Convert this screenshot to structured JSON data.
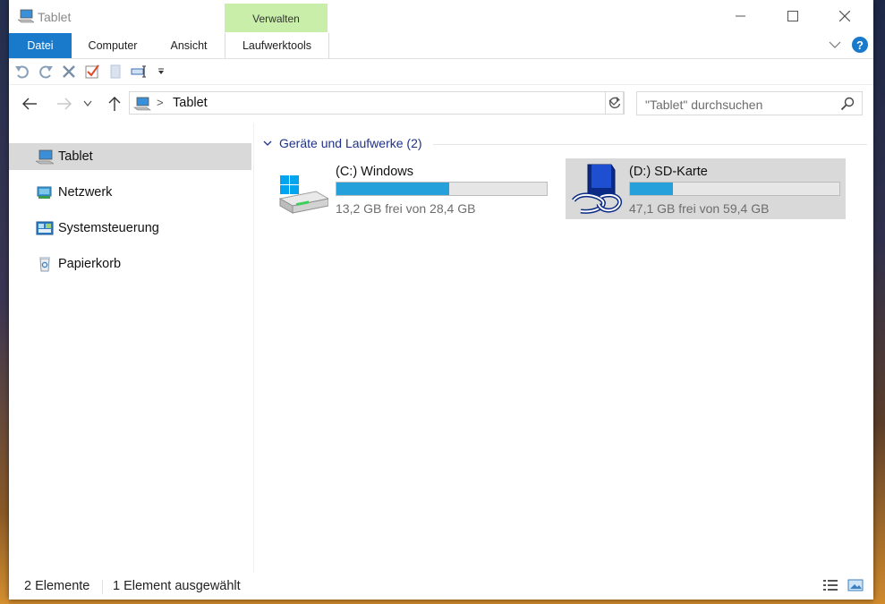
{
  "window": {
    "title": "Tablet",
    "context_group": "Verwalten"
  },
  "ribbon": {
    "tabs": [
      {
        "label": "Datei"
      },
      {
        "label": "Computer"
      },
      {
        "label": "Ansicht"
      },
      {
        "label": "Laufwerktools"
      }
    ]
  },
  "help": {
    "label": "?"
  },
  "address": {
    "path": "Tablet",
    "separator": ">"
  },
  "search": {
    "placeholder": "\"Tablet\" durchsuchen"
  },
  "nav": {
    "items": [
      {
        "label": "Tablet",
        "icon": "computer-icon",
        "selected": true
      },
      {
        "label": "Netzwerk",
        "icon": "network-icon"
      },
      {
        "label": "Systemsteuerung",
        "icon": "control-panel-icon"
      },
      {
        "label": "Papierkorb",
        "icon": "recycle-bin-icon"
      }
    ]
  },
  "content": {
    "group_title": "Geräte und Laufwerke (2)",
    "drives": [
      {
        "name": "(C:) Windows",
        "free_text": "13,2 GB frei von 28,4 GB",
        "used_fraction": 0.535,
        "icon": "hard-drive-icon"
      },
      {
        "name": "(D:) SD-Karte",
        "free_text": "47,1 GB frei von 59,4 GB",
        "used_fraction": 0.207,
        "icon": "sd-card-icon",
        "selected": true
      }
    ]
  },
  "status": {
    "count": "2 Elemente",
    "selection": "1 Element ausgewählt"
  },
  "colors": {
    "accent": "#1979ca",
    "progress": "#26a0da",
    "context_tab": "#c8eeaa",
    "selection": "#d9d9d9"
  }
}
